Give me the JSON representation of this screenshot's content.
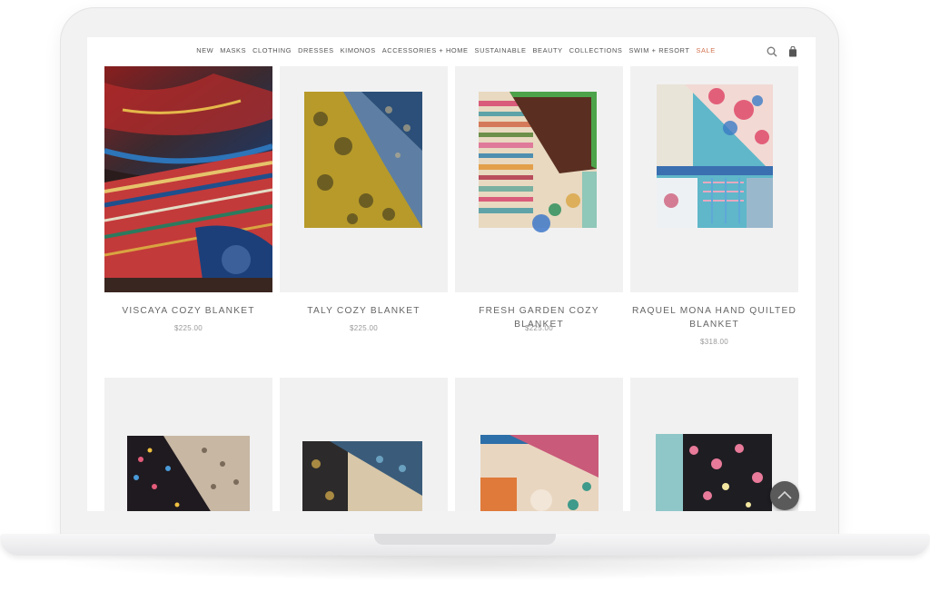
{
  "nav": {
    "items": [
      "NEW",
      "MASKS",
      "CLOTHING",
      "DRESSES",
      "KIMONOS",
      "ACCESSORIES + HOME",
      "SUSTAINABLE",
      "BEAUTY",
      "COLLECTIONS",
      "SWIM + RESORT"
    ],
    "sale_label": "SALE",
    "sale_color": "#d2724f"
  },
  "header_icons": [
    "search-icon",
    "shopping-bag-icon"
  ],
  "products": [
    {
      "name": "VISCAYA COZY BLANKET",
      "price": "$225.00"
    },
    {
      "name": "TALY COZY BLANKET",
      "price": "$225.00"
    },
    {
      "name": "FRESH GARDEN COZY BLANKET",
      "price": "$225.00"
    },
    {
      "name": "RAQUEL MONA HAND QUILTED BLANKET",
      "price": "$318.00"
    }
  ],
  "floating": {
    "scroll_top_icon": "chevron-up-icon"
  }
}
